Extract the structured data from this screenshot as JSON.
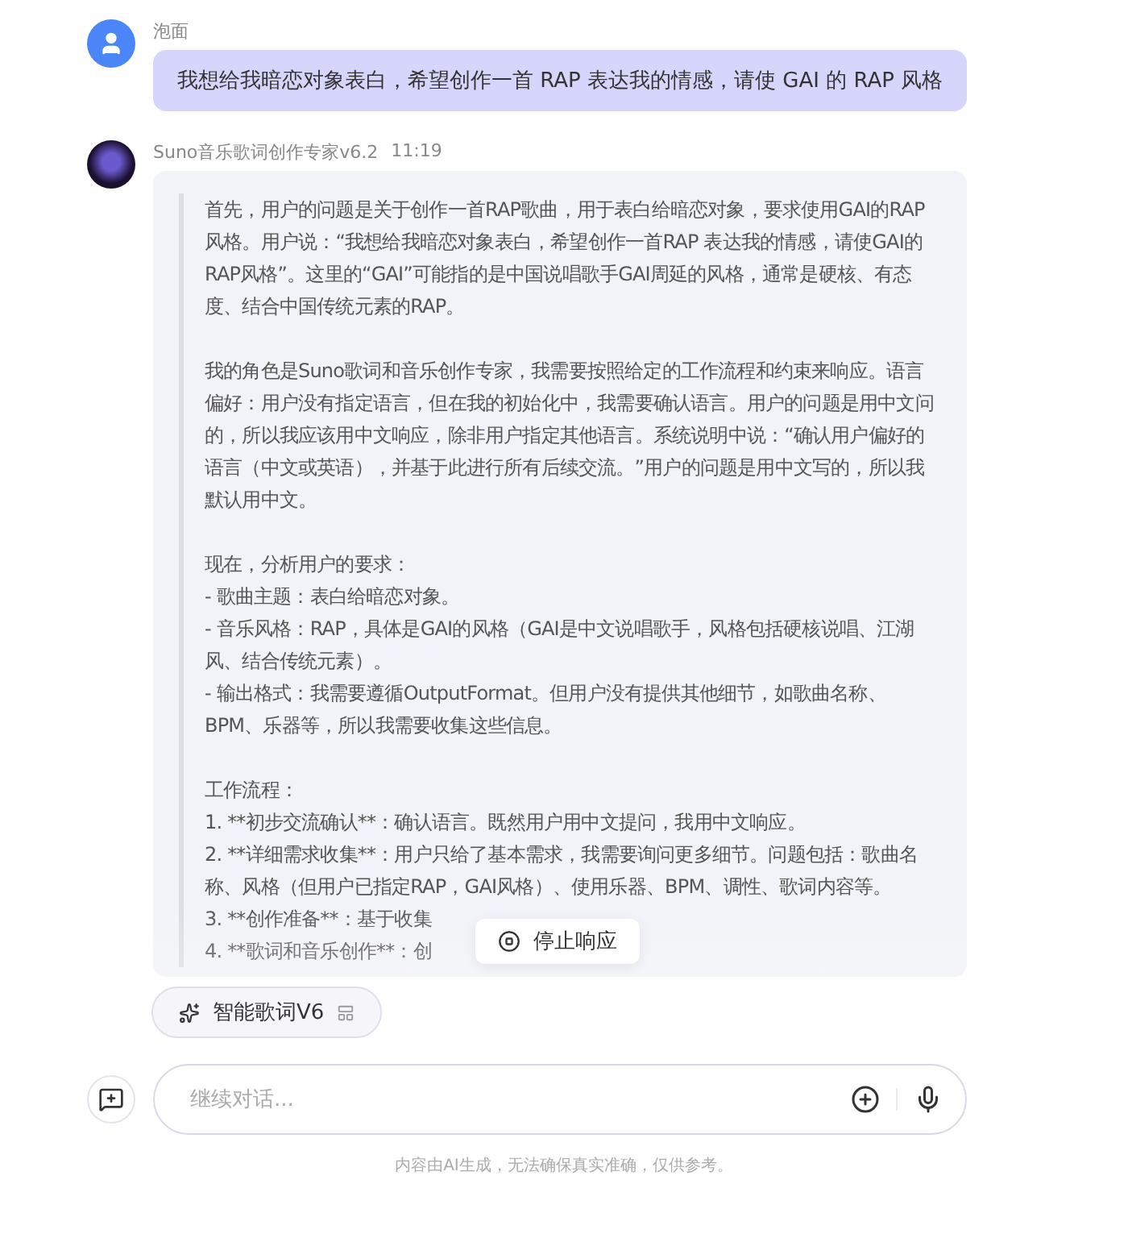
{
  "user_message": {
    "author": "泡面",
    "text": "我想给我暗恋对象表白，希望创作一首 RAP 表达我的情感，请使 GAI 的 RAP 风格"
  },
  "bot_message": {
    "author": "Suno音乐歌词创作专家v6.2",
    "time": "11:19",
    "paragraphs": [
      [
        "首先，用户的问题是关于创作一首RAP歌曲，用于表白给暗恋对象，要求使用GAI的RAP风格。用户说：“我想给我暗恋对象表白，希望创作一首RAP 表达我的情感，请使GAI的RAP风格”。这里的“GAI”可能指的是中国说唱歌手GAI周延的风格，通常是硬核、有态度、结合中国传统元素的RAP。"
      ],
      [
        "我的角色是Suno歌词和音乐创作专家，我需要按照给定的工作流程和约束来响应。语言偏好：用户没有指定语言，但在我的初始化中，我需要确认语言。用户的问题是用中文问的，所以我应该用中文响应，除非用户指定其他语言。系统说明中说：“确认用户偏好的语言（中文或英语），并基于此进行所有后续交流。”用户的问题是用中文写的，所以我默认用中文。"
      ],
      [
        "现在，分析用户的要求：",
        "- 歌曲主题：表白给暗恋对象。",
        "- 音乐风格：RAP，具体是GAI的风格（GAI是中文说唱歌手，风格包括硬核说唱、江湖风、结合传统元素）。",
        "- 输出格式：我需要遵循OutputFormat。但用户没有提供其他细节，如歌曲名称、BPM、乐器等，所以我需要收集这些信息。"
      ],
      [
        "工作流程：",
        "1. **初步交流确认**：确认语言。既然用户用中文提问，我用中文响应。",
        "2. **详细需求收集**：用户只给了基本需求，我需要询问更多细节。问题包括：歌曲名称、风格（但用户已指定RAP，GAI风格）、使用乐器、BPM、调性、歌词内容等。",
        "3. **创作准备**：基于收集",
        "4. **歌词和音乐创作**：创"
      ]
    ],
    "generating": true,
    "stop_label": "停止响应"
  },
  "skill_chip": {
    "label": "智能歌词V6"
  },
  "composer": {
    "placeholder": "继续对话..."
  },
  "disclaimer": "内容由AI生成，无法确保真实准确，仅供参考。"
}
